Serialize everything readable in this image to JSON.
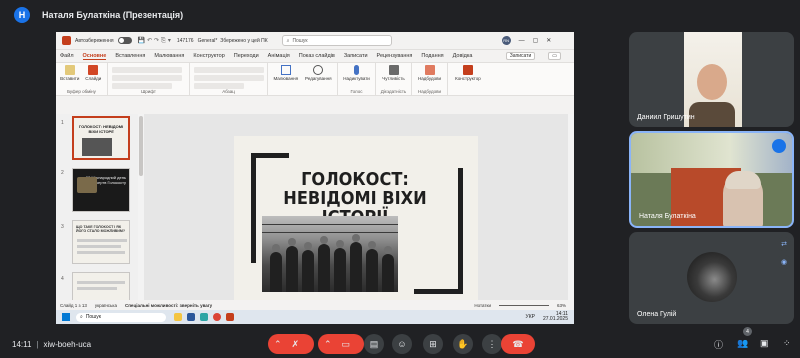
{
  "meet": {
    "presenter_badge": "H",
    "presenter_title": "Наталя Булаткіна (Презентація)",
    "clock": "14:11",
    "separator": "|",
    "meeting_code": "xiw-boeh-uca",
    "participant_count": "4"
  },
  "ppt": {
    "autosave_label": "Автозбереження",
    "doc_name": "147176",
    "sensitivity": "General*",
    "save_status": "Збережено у цей ПК",
    "search_placeholder": "Пошук",
    "user_initials": "RN",
    "tabs": [
      "Файл",
      "Основне",
      "Вставлення",
      "Малювання",
      "Конструктор",
      "Переходи",
      "Анімація",
      "Показ слайдів",
      "Записати",
      "Рецензування",
      "Подання",
      "Довідка"
    ],
    "record_button": "Записати",
    "ribbon": {
      "paste": "Вставити",
      "slides": "Слайди",
      "clipboard_group": "Буфер обміну",
      "font_group": "Шрифт",
      "paragraph_group": "Абзац",
      "drawing": "Малювання",
      "editing": "Редагування",
      "dictate": "Надиктувати",
      "voice_group": "Голос",
      "add_ins": "Надбудови",
      "add_ins_group": "Надбудови",
      "designer": "Конструктор",
      "sensitivity_label": "Чутливість",
      "sensitivity_group": "Дієздатність"
    },
    "slide": {
      "title_line1": "ГОЛОКОСТ:",
      "title_line2": "НЕВІДОМІ ВІХИ ІСТОРІЇ"
    },
    "thumbs": [
      {
        "num": "1",
        "text": "ГОЛОКОСТ: НЕВІДОМІ ВІХИ ІСТОРІЇ"
      },
      {
        "num": "2",
        "text": "27 Міжнародний день пам'яті жертв Голокосту"
      },
      {
        "num": "3",
        "text": "ЩО ТАКЕ ГОЛОКОСТ І ЯК ЙОГО СТАЛО МОЖЛИВИМ?"
      },
      {
        "num": "4",
        "text": ""
      }
    ],
    "status": {
      "slide_count": "Слайд 1 з 13",
      "language": "українська",
      "accessibility": "Спеціальні можливості: зверніть увагу",
      "notes": "Нотатки",
      "zoom": "63%"
    },
    "taskbar": {
      "search": "Пошук",
      "lang": "УКР",
      "time": "14:11",
      "date": "27.01.2025"
    }
  },
  "participants": [
    {
      "name": "Даниил Гришутин"
    },
    {
      "name": "Наталя Булаткіна"
    },
    {
      "name": "Олена Гулій"
    }
  ],
  "colors": {
    "meet_bg": "#202124",
    "accent_blue": "#1a73e8",
    "leave_red": "#ea4335",
    "ppt_accent": "#c43e1c"
  }
}
